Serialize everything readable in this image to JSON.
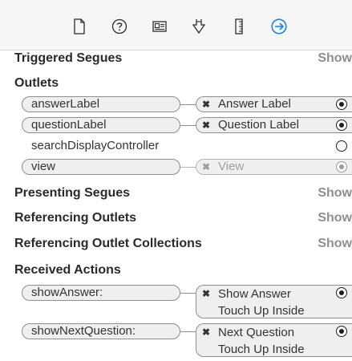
{
  "toolbar": {
    "icons": [
      "file-icon",
      "help-icon",
      "identity-icon",
      "attributes-icon",
      "size-icon",
      "connections-icon"
    ],
    "active_color": "#1a82f7"
  },
  "sections": {
    "triggered_segues": {
      "title": "Triggered Segues",
      "action": "Show"
    },
    "outlets": {
      "title": "Outlets"
    },
    "presenting_segues": {
      "title": "Presenting Segues",
      "action": "Show"
    },
    "referencing_outlets": {
      "title": "Referencing Outlets",
      "action": "Show"
    },
    "referencing_outlet_collections": {
      "title": "Referencing Outlet Collections",
      "action": "Show"
    },
    "received_actions": {
      "title": "Received Actions"
    }
  },
  "outlets": [
    {
      "name": "answerLabel",
      "target": "Answer Label",
      "connected": true,
      "dim": false
    },
    {
      "name": "questionLabel",
      "target": "Question Label",
      "connected": true,
      "dim": false
    },
    {
      "name": "searchDisplayController",
      "target": "",
      "connected": false,
      "dim": false
    },
    {
      "name": "view",
      "target": "View",
      "connected": true,
      "dim": true
    }
  ],
  "actions": [
    {
      "name": "showAnswer:",
      "target_line1": "Show Answer",
      "target_line2": "Touch Up Inside"
    },
    {
      "name": "showNextQuestion:",
      "target_line1": "Next Question",
      "target_line2": "Touch Up Inside"
    }
  ],
  "glyphs": {
    "disconnect": "✖"
  }
}
